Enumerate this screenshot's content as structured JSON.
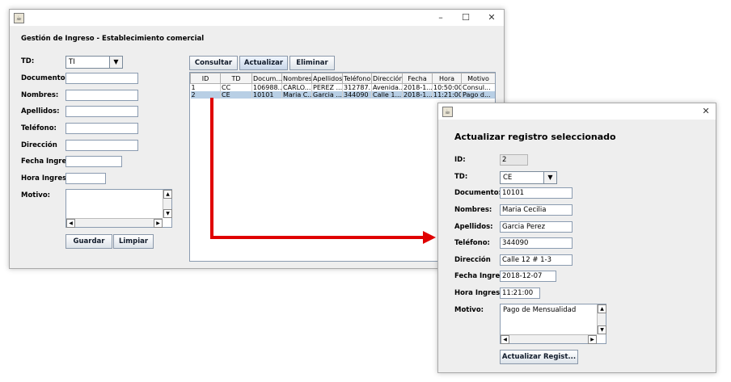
{
  "main_window": {
    "title": "",
    "form_title": "Gestión de Ingreso - Establecimiento comercial",
    "labels": {
      "td": "TD:",
      "documento": "Documento:",
      "nombres": "Nombres:",
      "apellidos": "Apellidos:",
      "telefono": "Teléfono:",
      "direccion": "Dirección",
      "fecha": "Fecha Ingre...",
      "hora": "Hora Ingreso:",
      "motivo": "Motivo:"
    },
    "td_value": "TI",
    "buttons": {
      "guardar": "Guardar",
      "limpiar": "Limpiar",
      "consultar": "Consultar",
      "actualizar": "Actualizar",
      "eliminar": "Eliminar"
    },
    "table": {
      "columns": [
        "ID",
        "TD",
        "Docum...",
        "Nombres",
        "Apellidos",
        "Teléfono",
        "Dirección",
        "Fecha",
        "Hora",
        "Motivo"
      ],
      "rows": [
        [
          "1",
          "CC",
          "106988...",
          "CARLO...",
          "PEREZ ...",
          "312787...",
          "Avenida...",
          "2018-1...",
          "10:50:00",
          "Consul..."
        ],
        [
          "2",
          "CE",
          "10101",
          "Maria C...",
          "Garcia ...",
          "344090",
          "Calle 1...",
          "2018-1...",
          "11:21:00",
          "Pago d..."
        ]
      ],
      "selected_row": 1
    }
  },
  "dialog": {
    "heading": "Actualizar registro seleccionado",
    "labels": {
      "id": "ID:",
      "td": "TD:",
      "documento": "Documento:",
      "nombres": "Nombres:",
      "apellidos": "Apellidos:",
      "telefono": "Teléfono:",
      "direccion": "Dirección",
      "fecha": "Fecha Ingre...",
      "hora": "Hora Ingreso:",
      "motivo": "Motivo:"
    },
    "values": {
      "id": "2",
      "td": "CE",
      "documento": "10101",
      "nombres": "Maria Cecilia",
      "apellidos": "Garcia Perez",
      "telefono": "344090",
      "direccion": "Calle 12 # 1-3",
      "fecha": "2018-12-07",
      "hora": "11:21:00",
      "motivo": "Pago de Mensualidad"
    },
    "update_button": "Actualizar Regist..."
  },
  "colors": {
    "arrow": "#e00000",
    "selection": "#b8cfe5",
    "window_bg": "#eeeeee"
  },
  "icons": {
    "app": "java-cup-icon",
    "minimize": "minimize-icon",
    "maximize": "maximize-icon",
    "close": "close-icon"
  }
}
